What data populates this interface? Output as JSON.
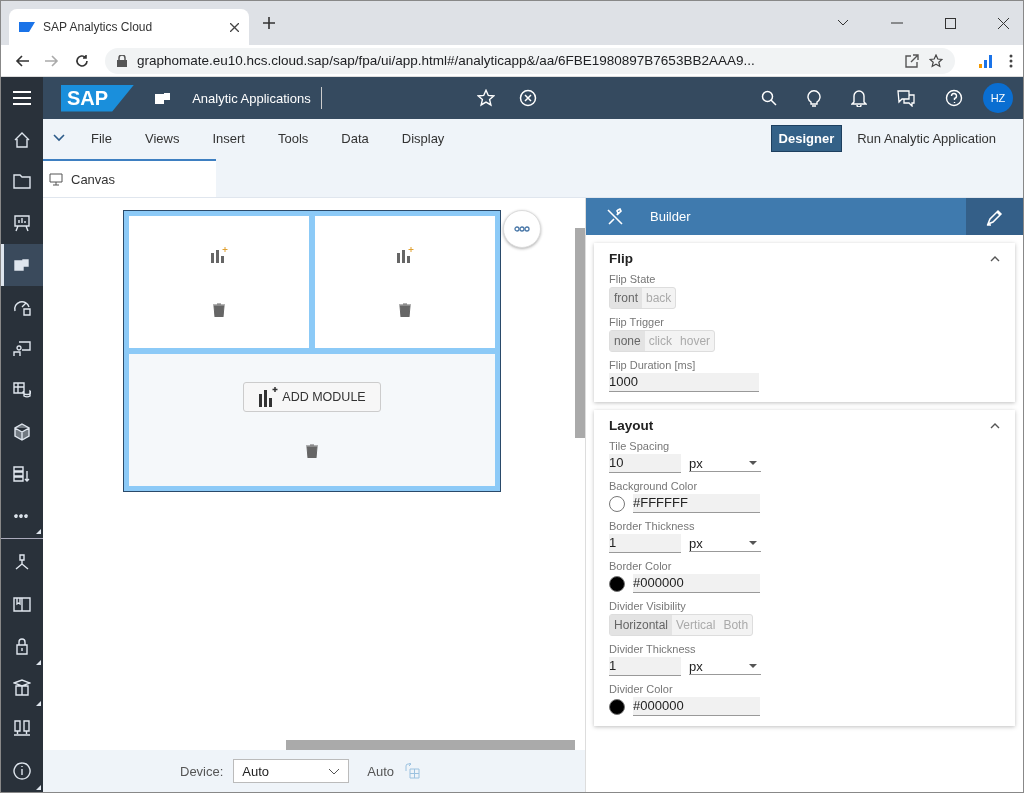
{
  "browser": {
    "tab_title": "SAP Analytics Cloud",
    "url": "graphomate.eu10.hcs.cloud.sap/sap/fpa/ui/app.html#/analyticapp&/aa/6FBE1980897B7653BB2AAA9..."
  },
  "shell": {
    "logo": "SAP",
    "app_title": "Analytic Applications",
    "avatar": "HZ"
  },
  "sidebar": {
    "items": [
      {
        "selected": false,
        "submenu": false
      },
      {
        "selected": false,
        "submenu": false
      },
      {
        "selected": false,
        "submenu": false
      },
      {
        "selected": true,
        "submenu": false
      },
      {
        "selected": false,
        "submenu": false
      },
      {
        "selected": false,
        "submenu": false
      },
      {
        "selected": false,
        "submenu": false
      },
      {
        "selected": false,
        "submenu": false
      },
      {
        "selected": false,
        "submenu": false
      },
      {
        "selected": false,
        "submenu": true
      },
      {
        "selected": false,
        "submenu": false
      },
      {
        "selected": false,
        "submenu": false
      },
      {
        "selected": false,
        "submenu": true
      },
      {
        "selected": false,
        "submenu": true
      },
      {
        "selected": false,
        "submenu": false
      },
      {
        "selected": false,
        "submenu": true
      }
    ]
  },
  "menu": {
    "items": [
      "File",
      "Views",
      "Insert",
      "Tools",
      "Data",
      "Display"
    ],
    "modes": [
      {
        "label": "Designer",
        "selected": true
      },
      {
        "label": "Run Analytic Application",
        "selected": false
      }
    ]
  },
  "canvas_tab": "Canvas",
  "canvas": {
    "add_module": "ADD MODULE"
  },
  "footer": {
    "device_label": "Device:",
    "device_value": "Auto",
    "auto_label": "Auto"
  },
  "builder": {
    "title": "Builder",
    "sections": [
      {
        "title": "Flip",
        "expanded": true,
        "fields": [
          {
            "kind": "segmented",
            "label": "Flip State",
            "options": [
              {
                "label": "front",
                "selected": true
              },
              {
                "label": "back",
                "selected": false
              }
            ]
          },
          {
            "kind": "segmented",
            "label": "Flip Trigger",
            "options": [
              {
                "label": "none",
                "selected": true
              },
              {
                "label": "click",
                "selected": false
              },
              {
                "label": "hover",
                "selected": false
              }
            ]
          },
          {
            "kind": "input",
            "label": "Flip Duration [ms]",
            "value": "1000"
          }
        ]
      },
      {
        "title": "Layout",
        "expanded": true,
        "fields": [
          {
            "kind": "unit",
            "label": "Tile Spacing",
            "value": "10",
            "unit": "px"
          },
          {
            "kind": "color",
            "label": "Background Color",
            "value": "#FFFFFF",
            "color": "#ffffff"
          },
          {
            "kind": "unit",
            "label": "Border Thickness",
            "value": "1",
            "unit": "px"
          },
          {
            "kind": "color",
            "label": "Border Color",
            "value": "#000000",
            "color": "#000000"
          },
          {
            "kind": "segmented",
            "label": "Divider Visibility",
            "options": [
              {
                "label": "Horizontal",
                "selected": true
              },
              {
                "label": "Vertical",
                "selected": false
              },
              {
                "label": "Both",
                "selected": false
              }
            ]
          },
          {
            "kind": "unit",
            "label": "Divider Thickness",
            "value": "1",
            "unit": "px"
          },
          {
            "kind": "color",
            "label": "Divider Color",
            "value": "#000000",
            "color": "#000000"
          }
        ]
      }
    ]
  }
}
